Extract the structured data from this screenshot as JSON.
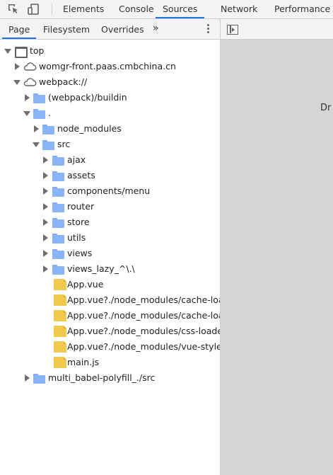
{
  "toolbar": {
    "icons": [
      "inspect-element-icon",
      "device-toolbar-icon"
    ],
    "tabs": [
      {
        "label": "Elements",
        "active": false
      },
      {
        "label": "Console",
        "active": false
      },
      {
        "label": "Sources",
        "active": true
      },
      {
        "label": "Network",
        "active": false
      },
      {
        "label": "Performance",
        "active": false
      }
    ]
  },
  "navigator": {
    "tabs": [
      {
        "label": "Page",
        "active": true
      },
      {
        "label": "Filesystem",
        "active": false
      },
      {
        "label": "Overrides",
        "active": false
      }
    ],
    "more_tabs_glyph": "»",
    "tree": [
      {
        "label": "top",
        "icon": "frame-icon",
        "expanded": true
      },
      {
        "label": "womgr-front.paas.cmbchina.cn",
        "icon": "cloud-icon",
        "expanded": false
      },
      {
        "label": "webpack://",
        "icon": "cloud-icon",
        "expanded": true
      },
      {
        "label": "(webpack)/buildin",
        "icon": "folder-icon",
        "expanded": false
      },
      {
        "label": ".",
        "icon": "folder-icon",
        "expanded": true
      },
      {
        "label": "node_modules",
        "icon": "folder-icon",
        "expanded": false
      },
      {
        "label": "src",
        "icon": "folder-icon",
        "expanded": true
      },
      {
        "label": "ajax",
        "icon": "folder-icon",
        "expanded": false
      },
      {
        "label": "assets",
        "icon": "folder-icon",
        "expanded": false
      },
      {
        "label": "components/menu",
        "icon": "folder-icon",
        "expanded": false
      },
      {
        "label": "router",
        "icon": "folder-icon",
        "expanded": false
      },
      {
        "label": "store",
        "icon": "folder-icon",
        "expanded": false
      },
      {
        "label": "utils",
        "icon": "folder-icon",
        "expanded": false
      },
      {
        "label": "views",
        "icon": "folder-icon",
        "expanded": false
      },
      {
        "label": "views_lazy_^\\.\\",
        "icon": "folder-icon",
        "expanded": false
      },
      {
        "label": "App.vue",
        "icon": "file-icon"
      },
      {
        "label": "App.vue?./node_modules/cache-load",
        "icon": "file-icon"
      },
      {
        "label": "App.vue?./node_modules/cache-load",
        "icon": "file-icon"
      },
      {
        "label": "App.vue?./node_modules/css-loader/",
        "icon": "file-icon"
      },
      {
        "label": "App.vue?./node_modules/vue-style-lo",
        "icon": "file-icon"
      },
      {
        "label": "main.js",
        "icon": "file-icon"
      },
      {
        "label": "multi_babel-polyfill_./src",
        "icon": "folder-icon",
        "expanded": false
      }
    ]
  },
  "editor": {
    "drop_hint": "Dr"
  },
  "colors": {
    "accent": "#1a73e8",
    "folder": "#8ab4f8",
    "file": "#f2c94c",
    "editor_bg": "#d6d6d6"
  }
}
